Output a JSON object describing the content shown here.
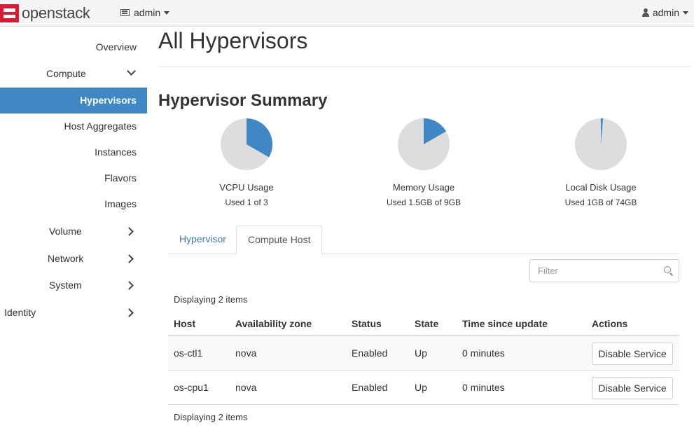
{
  "navbar": {
    "brand": "openstack",
    "project_label": "admin",
    "user_label": "admin"
  },
  "sidebar": {
    "items": [
      {
        "label": "Overview"
      },
      {
        "label": "Compute"
      },
      {
        "label": "Hypervisors"
      },
      {
        "label": "Host Aggregates"
      },
      {
        "label": "Instances"
      },
      {
        "label": "Flavors"
      },
      {
        "label": "Images"
      },
      {
        "label": "Volume"
      },
      {
        "label": "Network"
      },
      {
        "label": "System"
      },
      {
        "label": "Identity"
      }
    ]
  },
  "page": {
    "title": "All Hypervisors",
    "summary_title": "Hypervisor Summary"
  },
  "summary": [
    {
      "label": "VCPU Usage",
      "sub": "Used 1 of 3",
      "used_fraction": 0.3333
    },
    {
      "label": "Memory Usage",
      "sub": "Used 1.5GB of 9GB",
      "used_fraction": 0.1667
    },
    {
      "label": "Local Disk Usage",
      "sub": "Used 1GB of 74GB",
      "used_fraction": 0.0135
    }
  ],
  "colors": {
    "used": "#3f88c5",
    "free": "#dddddd",
    "active_nav": "#3f88c5",
    "brand_red": "#da1a32"
  },
  "tabs": [
    {
      "label": "Hypervisor"
    },
    {
      "label": "Compute Host"
    }
  ],
  "filter": {
    "placeholder": "Filter"
  },
  "table": {
    "count_label": "Displaying 2 items",
    "columns": [
      "Host",
      "Availability zone",
      "Status",
      "State",
      "Time since update",
      "Actions"
    ],
    "rows": [
      {
        "host": "os-ctl1",
        "zone": "nova",
        "status": "Enabled",
        "state": "Up",
        "time": "0 minutes",
        "action": "Disable Service"
      },
      {
        "host": "os-cpu1",
        "zone": "nova",
        "status": "Enabled",
        "state": "Up",
        "time": "0 minutes",
        "action": "Disable Service"
      }
    ]
  }
}
